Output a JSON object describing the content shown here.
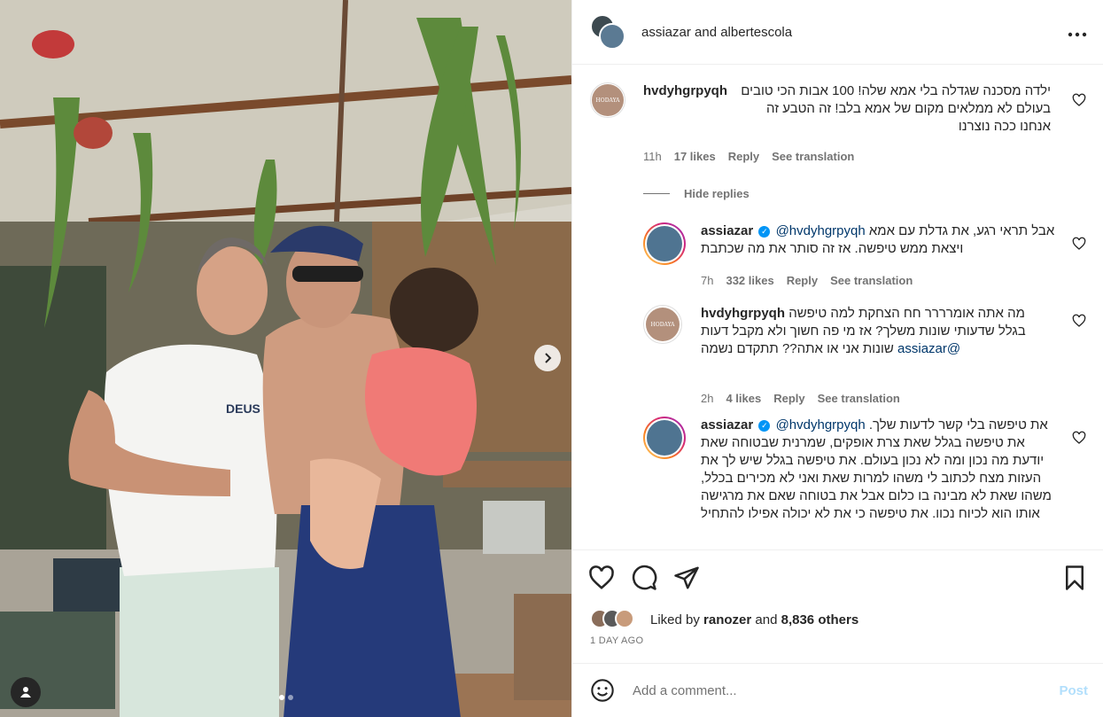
{
  "header": {
    "title": "assiazar and albertescola",
    "more_icon": "more-horizontal-icon"
  },
  "media": {
    "next_icon": "chevron-right-icon",
    "dots": 2,
    "active_dot": 0,
    "tag_icon": "user-tag-icon",
    "photo_shirt_text": "DEUS"
  },
  "comments": [
    {
      "user": "hvdyhgrpyqh",
      "avatar_text": "HODAYA",
      "text": "ילדה מסכנה שגדלה בלי אמא שלה! 100 אבות הכי טובים בעולם לא ממלאים מקום של אמא בלב! זה הטבע זה אנחנו ככה נוצרנו",
      "time": "11h",
      "likes": "17 likes",
      "reply": "Reply",
      "translate": "See translation"
    },
    {
      "user": "assiazar",
      "mention": "@hvdyhgrpyqh",
      "text": "אבל תראי רגע, את גדלת עם אמא ויצאת ממש טיפשה. אז זה סותר את מה שכתבת",
      "time": "7h",
      "likes": "332 likes",
      "reply": "Reply",
      "translate": "See translation"
    },
    {
      "user": "hvdyhgrpyqh",
      "avatar_text": "HODAYA",
      "text": "מה אתה אומרררר חח הצחקת למה טיפשה בגלל שדעותי שונות משלך? אז מי פה חשוך ולא מקבל דעות שונות אני או אתה?? תתקדם נשמה",
      "mention_end": "assiazar@",
      "time": "2h",
      "likes": "4 likes",
      "reply": "Reply",
      "translate": "See translation"
    },
    {
      "user": "assiazar",
      "mention": "@hvdyhgrpyqh",
      "text": "את טיפשה בלי קשר לדעות שלך. את טיפשה בגלל שאת צרת אופקים, שמרנית שבטוחה שאת יודעת מה נכון ומה לא נכון בעולם. את טיפשה בגלל שיש לך את העזות מצח לכתוב לי משהו למרות שאת ואני לא מכירים בכלל, משהו שאת לא מבינה בו כלום אבל את בטוחה שאם את מרגישה אותו הוא לכיוח נכוו. את טיפשה כי את לא יכולה אפילו להתחיל"
    }
  ],
  "hide_replies": "Hide replies",
  "actions": {
    "like_icon": "heart-icon",
    "comment_icon": "comment-icon",
    "share_icon": "send-icon",
    "save_icon": "bookmark-icon"
  },
  "likes_line": {
    "prefix": "Liked by",
    "user": "ranozer",
    "middle": "and",
    "others": "8,836 others"
  },
  "timestamp": "1 DAY AGO",
  "add_comment": {
    "placeholder": "Add a comment...",
    "post_label": "Post",
    "emoji_icon": "emoji-icon"
  },
  "colors": {
    "link": "#00376b",
    "muted": "#737373",
    "verified": "#0095f6",
    "post_disabled": "#b2dffc"
  }
}
